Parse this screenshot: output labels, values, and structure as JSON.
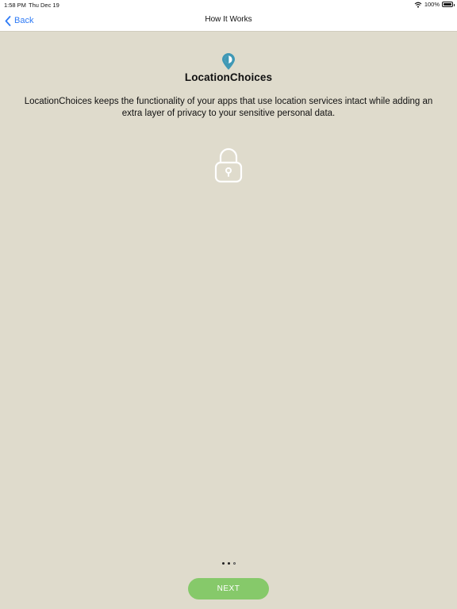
{
  "status_bar": {
    "time": "1:58 PM",
    "date": "Thu Dec 19",
    "battery_percent": "100%"
  },
  "nav": {
    "back_label": "Back",
    "title": "How It Works"
  },
  "main": {
    "app_name": "LocationChoices",
    "description": "LocationChoices keeps the functionality of your apps that use location services intact while adding an extra layer of privacy to your sensitive personal data.",
    "illustration_icon": "lock-icon"
  },
  "pager": {
    "page_count": 3,
    "current_page": 2
  },
  "footer": {
    "next_label": "NEXT"
  },
  "colors": {
    "background": "#dfdbcc",
    "accent_link": "#2f7bf6",
    "next_button": "#86c96a",
    "logo": "#3f98b5"
  }
}
